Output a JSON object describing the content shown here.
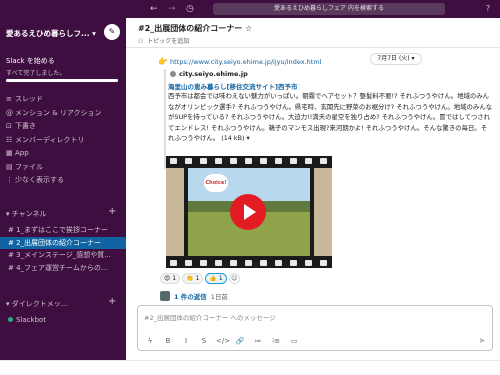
{
  "topbar": {
    "back_icon": "back-arrow-icon",
    "forward_icon": "forward-arrow-icon",
    "history_icon": "history-icon",
    "search_text": "愛あるえひめ暮らしフェア 内を検索する",
    "help_icon": "help-icon"
  },
  "sidebar": {
    "workspace_name": "愛あるえひめ暮らしフ...",
    "workspace_chevron": "▾",
    "slack_start_title": "Slack を始める",
    "slack_start_sub": "すべて完了しました。",
    "progress": 1.0,
    "nav": [
      {
        "icon": "≡",
        "label": "スレッド"
      },
      {
        "icon": "@",
        "label": "メンション & リアクション"
      },
      {
        "icon": "⊡",
        "label": "下書き"
      },
      {
        "icon": "☷",
        "label": "メンバーディレクトリ"
      },
      {
        "icon": "▦",
        "label": "App"
      },
      {
        "icon": "▤",
        "label": "ファイル"
      },
      {
        "icon": "⋮",
        "label": "少なく表示する"
      }
    ],
    "channels_header": "チャンネル",
    "channels": [
      {
        "label": "# 1_まずはここで挨拶コーナー",
        "active": false
      },
      {
        "label": "# 2_出展団体の紹介コーナー",
        "active": true
      },
      {
        "label": "# 3_メインステージ_感想や質...",
        "active": false
      },
      {
        "label": "# 4_フェア運営チームからの...",
        "active": false
      }
    ],
    "dm_header": "ダイレクトメッ...",
    "dm_user": "Slackbot"
  },
  "channel": {
    "title": "#2_出展団体の紹介コーナー ☆",
    "member_icon": "person-icon",
    "topic": "トピックを追加"
  },
  "message": {
    "date": "7月7日 (火) ▾",
    "link": "https://www.city.seiyo.ehime.jp/ijyu/index.html",
    "preview_site": "city.seiyo.ehime.jp",
    "preview_title": "海里山の恵み暮らし[移住交流サイト]西予市",
    "preview_body": "西予市は都会では味わえない魅力がいっぱい。朝霧でヘアセット？整髪料不要!? それふつうやけん。地域のみんながオリンピック選手? それふつうやけん。県宅時、玄関先に野菜のお裾分け? それふつうやけん。地域のみんながSUPを持っている? それふつうやけん。大迫力!!満天の星空を独り占め? それふつうやけん。冒ではしてつされてエンドレス! それふつうやけん。鵜子のマンモス出現?来河期かよ! それふつうやけん。そんな驚きの毎日。それふつうやけん。 (14 kB) ▾",
    "video_label": "Choice!",
    "reactions": [
      {
        "emoji": "😍",
        "count": "1",
        "mine": false
      },
      {
        "emoji": "👏",
        "count": "1",
        "mine": false
      },
      {
        "emoji": "👍",
        "count": "1",
        "mine": true
      }
    ],
    "add_reaction_icon": "☺",
    "thread_count": "1 件の返信",
    "thread_ago": "1日前"
  },
  "composer": {
    "placeholder": "#2_出展団体の紹介コーナー へのメッセージ",
    "tools": [
      "ϟ",
      "B",
      "I",
      "S",
      "</>",
      "🔗",
      "≔",
      "⁝≡",
      "▭"
    ],
    "send_icon": "➤"
  }
}
